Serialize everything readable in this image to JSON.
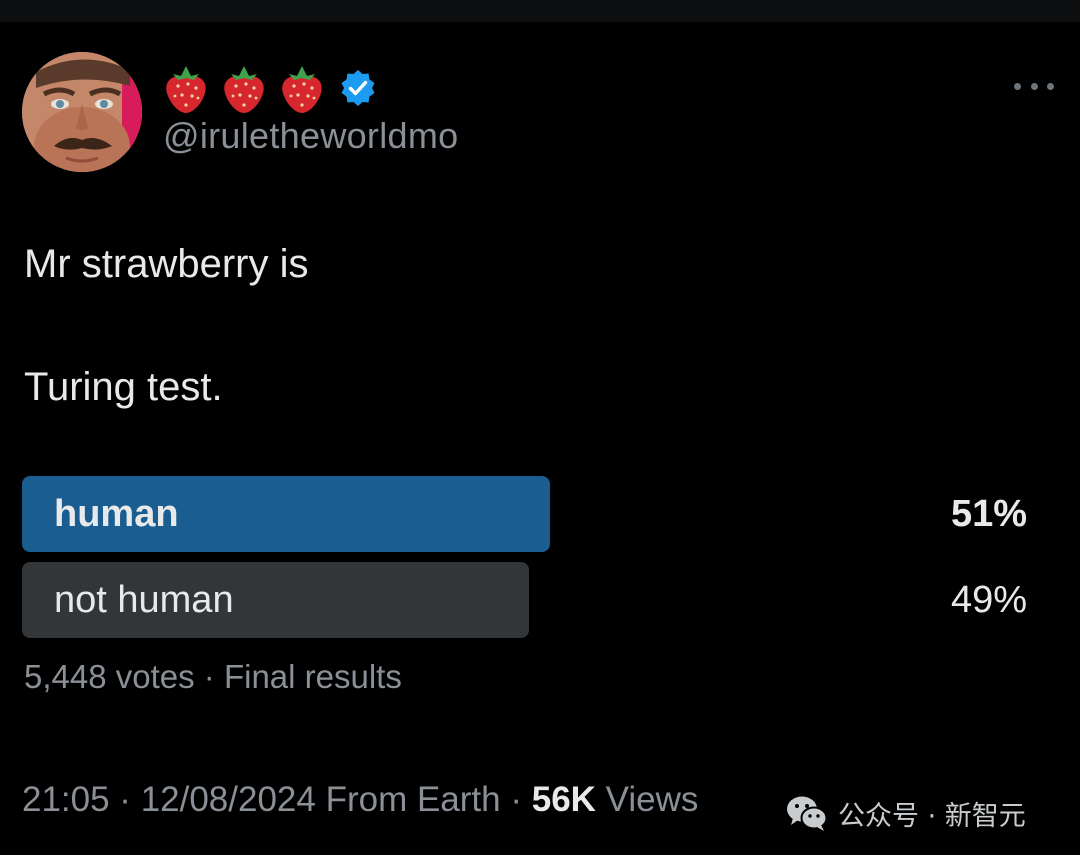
{
  "tweet": {
    "display_name_icons": [
      "strawberry-icon",
      "strawberry-icon",
      "strawberry-icon",
      "verified-badge-icon"
    ],
    "handle": "@iruletheworldmo",
    "text_line_1": "Mr strawberry is",
    "text_line_2": "Turing test.",
    "timestamp": "21:05 · 12/08/2024 From Earth · ",
    "views_count": "56K",
    "views_label": " Views"
  },
  "poll": {
    "options": [
      {
        "label": "human",
        "percent_text": "51%",
        "percent": 51,
        "winner": true
      },
      {
        "label": "not human",
        "percent_text": "49%",
        "percent": 49,
        "winner": false
      }
    ],
    "summary": "5,448 votes · Final results"
  },
  "watermark": {
    "text": "公众号 · 新智元",
    "icon": "wechat-icon"
  },
  "colors": {
    "background": "#000000",
    "winner_bar": "#1a5d91",
    "other_bar": "#333639",
    "verified": "#1d9bf0",
    "strawberry": "#d6262e",
    "secondary_text": "#8b9096"
  }
}
